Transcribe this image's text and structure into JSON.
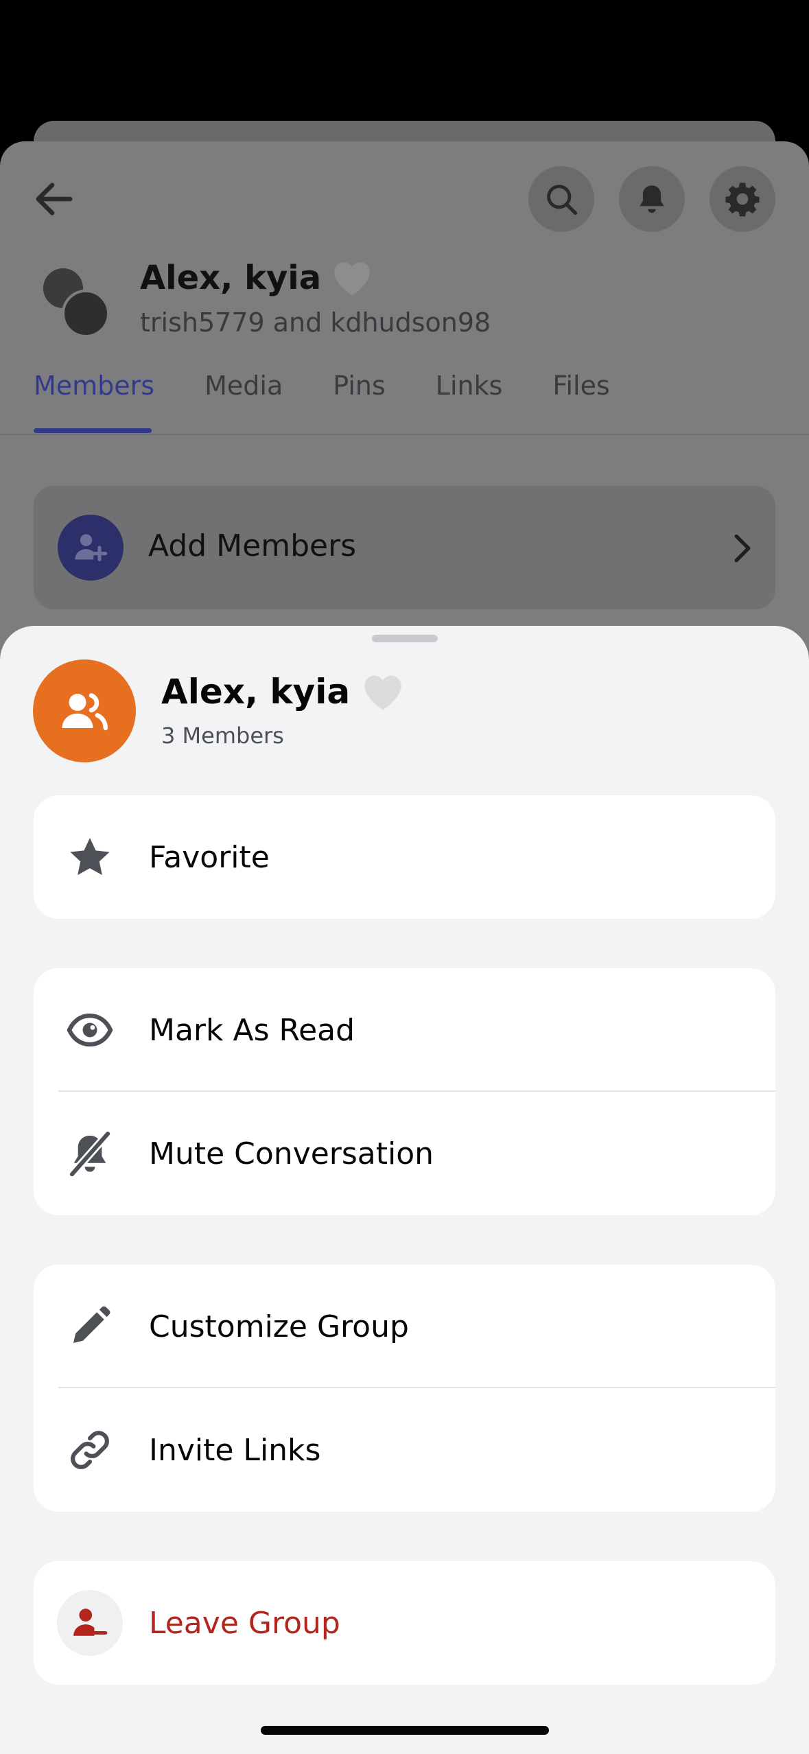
{
  "background": {
    "header": {
      "title": "Alex, kyia",
      "subtitle": "trish5779 and kdhudson98"
    },
    "tabs": [
      {
        "label": "Members",
        "active": true
      },
      {
        "label": "Media",
        "active": false
      },
      {
        "label": "Pins",
        "active": false
      },
      {
        "label": "Links",
        "active": false
      },
      {
        "label": "Files",
        "active": false
      }
    ],
    "add_members_label": "Add Members"
  },
  "sheet": {
    "title": "Alex, kyia",
    "member_count": "3 Members",
    "items": {
      "favorite": "Favorite",
      "mark_as_read": "Mark As Read",
      "mute_conversation": "Mute Conversation",
      "customize_group": "Customize Group",
      "invite_links": "Invite Links",
      "leave_group": "Leave Group"
    }
  },
  "colors": {
    "accent": "#5865F2",
    "group_avatar": "#E67020",
    "danger": "#B3261E",
    "sheet_background": "#F2F3F5"
  },
  "icons": [
    "arrow-left-icon",
    "search-icon",
    "bell-icon",
    "gear-icon",
    "heart-icon",
    "group-icon",
    "star-icon",
    "eye-icon",
    "bell-off-icon",
    "pencil-icon",
    "link-icon",
    "leave-icon",
    "add-member-icon",
    "chevron-right-icon"
  ]
}
